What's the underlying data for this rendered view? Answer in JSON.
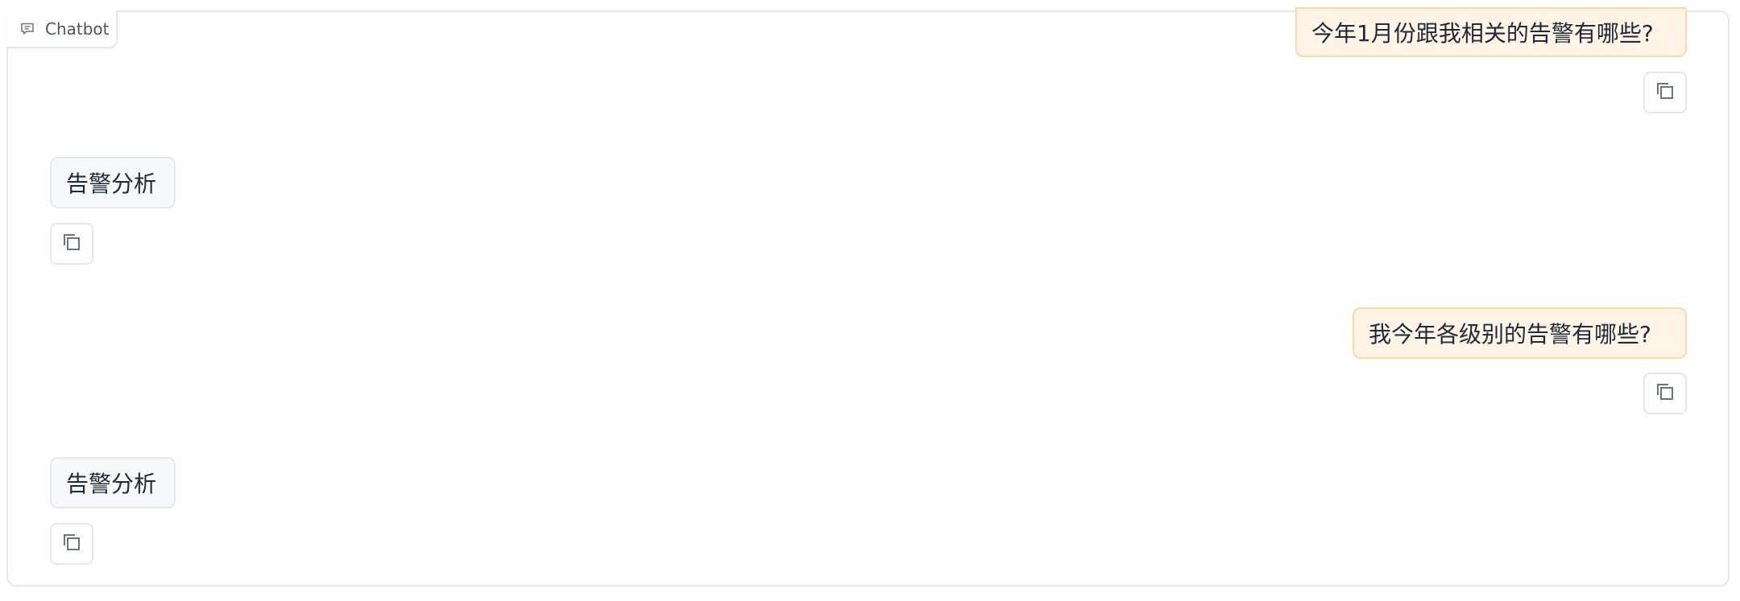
{
  "panel": {
    "label": "Chatbot",
    "label_icon": "chat-icon"
  },
  "messages": [
    {
      "role": "user",
      "text": "今年1月份跟我相关的告警有哪些?",
      "action_icon": "copy-icon"
    },
    {
      "role": "bot",
      "text": "告警分析",
      "action_icon": "copy-icon"
    },
    {
      "role": "user",
      "text": "我今年各级别的告警有哪些?",
      "action_icon": "copy-icon"
    },
    {
      "role": "bot",
      "text": "告警分析",
      "action_icon": "copy-icon"
    }
  ],
  "colors": {
    "user_bubble_bg": "#fff4e5",
    "user_bubble_border": "#fcd9a8",
    "bot_bubble_bg": "#f7f8fa",
    "border": "#e5e7eb"
  }
}
